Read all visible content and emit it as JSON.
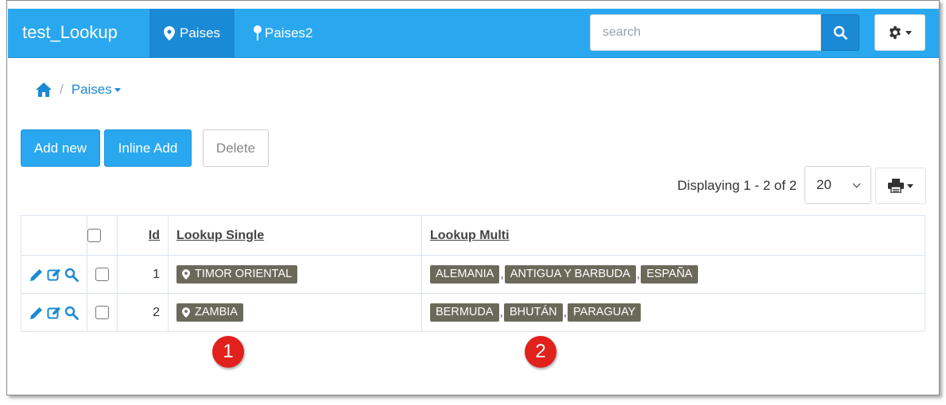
{
  "app": {
    "title": "test_Lookup"
  },
  "nav": {
    "tabs": [
      {
        "label": "Paises",
        "icon": "map-marker-icon",
        "active": true
      },
      {
        "label": "Paises2",
        "icon": "pushpin-icon",
        "active": false
      }
    ]
  },
  "search": {
    "placeholder": "search"
  },
  "breadcrumb": {
    "current": "Paises"
  },
  "toolbar": {
    "add_new_label": "Add new",
    "inline_add_label": "Inline Add",
    "delete_label": "Delete"
  },
  "pagination": {
    "summary": "Displaying 1 - 2 of 2",
    "page_size": "20"
  },
  "table": {
    "headers": {
      "id": "Id",
      "lookup_single": "Lookup Single",
      "lookup_multi": "Lookup Multi"
    },
    "rows": [
      {
        "id": "1",
        "lookup_single": "TIMOR ORIENTAL",
        "lookup_multi": [
          "ALEMANIA",
          "ANTIGUA Y BARBUDA",
          "ESPAÑA"
        ]
      },
      {
        "id": "2",
        "lookup_single": "ZAMBIA",
        "lookup_multi": [
          "BERMUDA",
          "BHUTÁN",
          "PARAGUAY"
        ]
      }
    ],
    "multi_separator": ","
  },
  "annotations": {
    "marker1": "1",
    "marker2": "2"
  },
  "colors": {
    "navbar": "#2aa8ef",
    "navbar_active": "#1a8ad6",
    "primary_button": "#2aa8ef",
    "tag": "#6b6a5a",
    "annotation_badge": "#e0211c",
    "link": "#1a8ad6"
  }
}
